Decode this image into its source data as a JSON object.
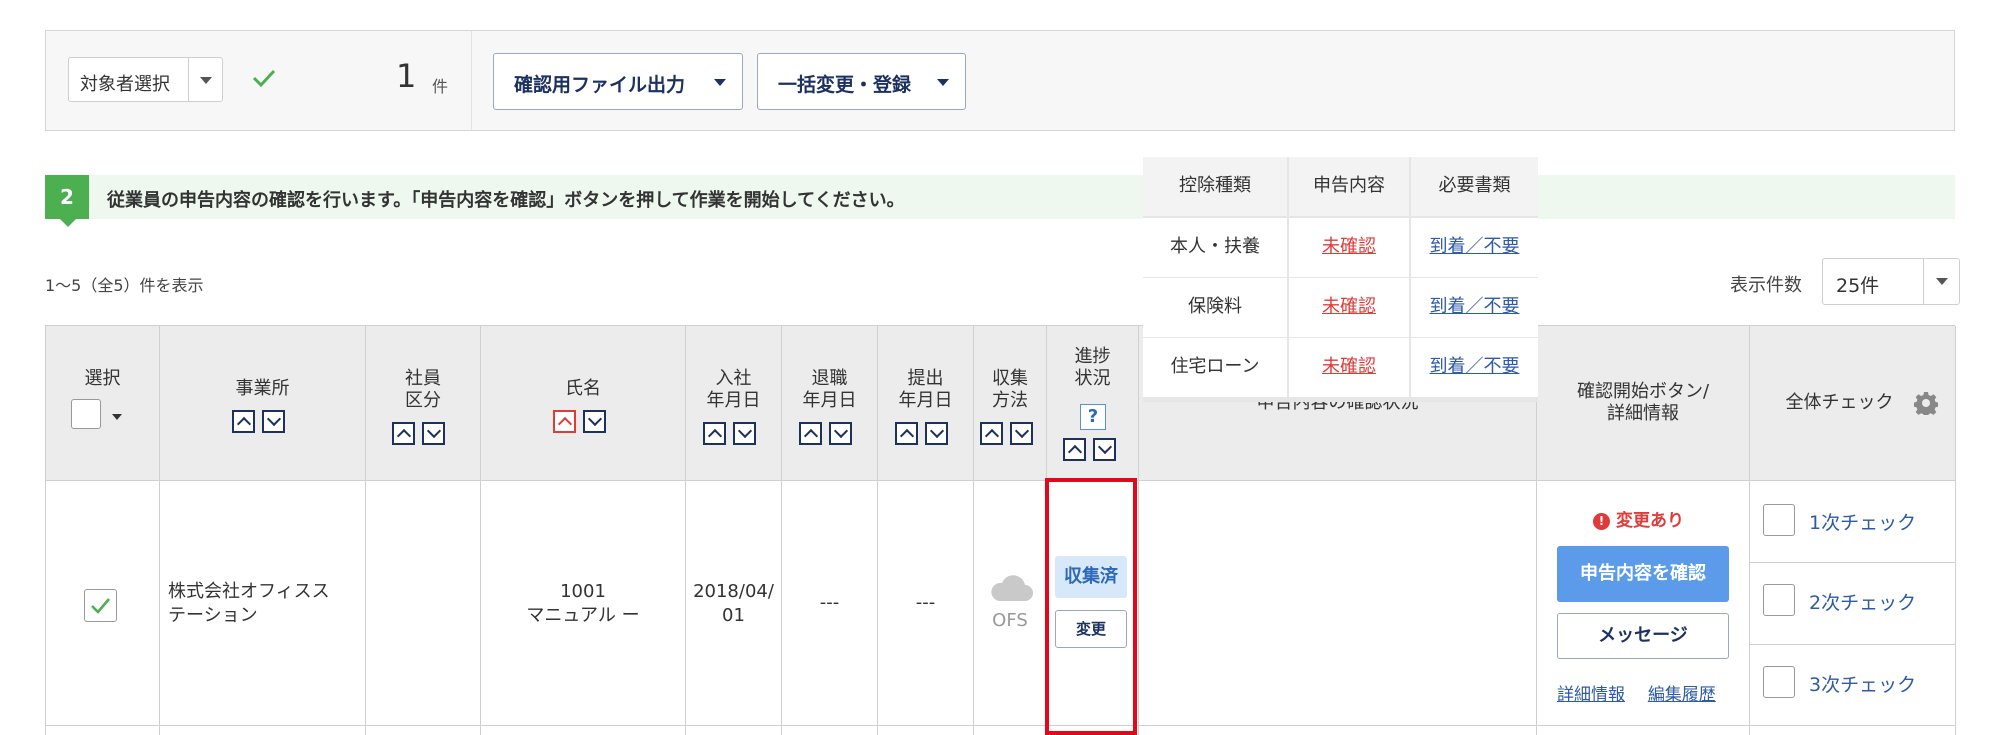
{
  "toolbar": {
    "target_select_label": "対象者選択",
    "count": "1",
    "count_unit": "件",
    "export_button": "確認用ファイル出力",
    "bulk_button": "一括変更・登録"
  },
  "step": {
    "number": "2",
    "message": "従業員の申告内容の確認を行います。「申告内容を確認」ボタンを押して作業を開始してください。"
  },
  "list": {
    "range_text": "1〜5（全5）件を表示",
    "per_page_label": "表示件数",
    "per_page_value": "25件"
  },
  "table": {
    "headers": {
      "select": "選択",
      "office": "事業所",
      "emp_type_1": "社員",
      "emp_type_2": "区分",
      "name": "氏名",
      "hire_1": "入社",
      "hire_2": "年月日",
      "retire_1": "退職",
      "retire_2": "年月日",
      "submit_1": "提出",
      "submit_2": "年月日",
      "collect_1": "収集",
      "collect_2": "方法",
      "progress_1": "進捗",
      "progress_2": "状況",
      "help": "?",
      "confirm_status": "申告内容の確認状況",
      "start_1": "確認開始ボタン/",
      "start_2": "詳細情報",
      "check_all": "全体チェック"
    },
    "row": {
      "office_1": "株式会社オフィスス",
      "office_2": "テーション",
      "emp_no": "1001",
      "name": "マニュアル ー",
      "hire_1": "2018/04/",
      "hire_2": "01",
      "retire": "---",
      "submit": "---",
      "collect": "OFS",
      "progress_badge": "収集済",
      "change_button": "変更",
      "sub_headers": [
        "控除種類",
        "申告内容",
        "必要書類"
      ],
      "sub_rows": [
        {
          "type": "本人・扶養",
          "content": "未確認",
          "docs": "到着／不要"
        },
        {
          "type": "保険料",
          "content": "未確認",
          "docs": "到着／不要"
        },
        {
          "type": "住宅ローン",
          "content": "未確認",
          "docs": "到着／不要"
        }
      ],
      "alert": "変更あり",
      "confirm_button": "申告内容を確認",
      "message_button": "メッセージ",
      "detail_link": "詳細情報",
      "history_link": "編集履歴",
      "checks": [
        "1次チェック",
        "2次チェック",
        "3次チェック"
      ]
    }
  },
  "colors": {
    "accent_green": "#4caf50",
    "link_blue": "#2e5aa6",
    "alert_red": "#e03b3b",
    "primary_button": "#5b9bea",
    "highlight_box": "#e3071b"
  }
}
